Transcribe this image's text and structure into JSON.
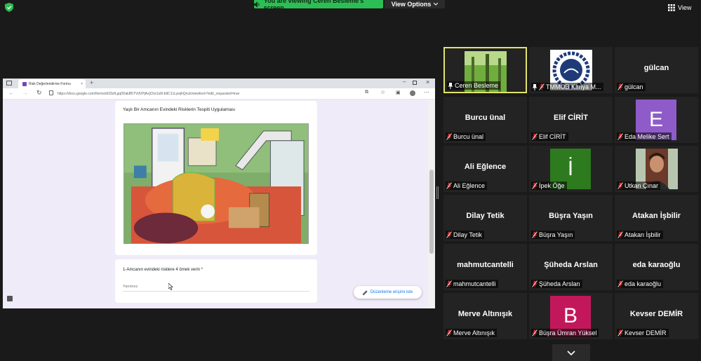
{
  "top_bar": {
    "banner_text": "You are viewing Ceren Besleme's screen",
    "view_options_label": "View Options",
    "view_label": "View"
  },
  "shared_screen": {
    "tab_title": "Risk Değerlendirme Formu",
    "url": "https://docs.google.com/forms/d/18zfLgq0DakB5TVdVPjAxjChx1o6l-b9C1cLywjhQnck/viewform?edit_requested=true",
    "form_title": "Yaşlı Bir Amcanın Evindeki Risklerin Tespiti Uygulaması",
    "question": "1-Amcanın evindeki risklere 4 örnek verin *",
    "answer_placeholder": "Yanıtınız",
    "edit_access_button": "Düzenleme erişimi iste"
  },
  "participants": [
    {
      "label": "Ceren Besleme",
      "display": "",
      "muted": false,
      "pinned": true,
      "active": true,
      "video": "forest"
    },
    {
      "label": "TMMOB Kimya M...",
      "display": "",
      "muted": true,
      "pinned": true,
      "video": "logo"
    },
    {
      "label": "gülcan",
      "display": "gülcan",
      "muted": true
    },
    {
      "label": "Burcu ünal",
      "display": "Burcu ünal",
      "muted": true
    },
    {
      "label": "Elif CİRİT",
      "display": "Elif CİRİT",
      "muted": true
    },
    {
      "label": "Eda Melike Sert",
      "display": "",
      "muted": true,
      "avatar_letter": "E",
      "avatar_color": "#8f5bc9"
    },
    {
      "label": "Ali Eğlence",
      "display": "Ali Eğlence",
      "muted": true
    },
    {
      "label": "İpek Öğe",
      "display": "",
      "muted": true,
      "avatar_letter": "İ",
      "avatar_color": "#2e7a1f"
    },
    {
      "label": "Utkan Çınar",
      "display": "",
      "muted": true,
      "video": "person"
    },
    {
      "label": "Dilay Tetik",
      "display": "Dilay Tetik",
      "muted": true
    },
    {
      "label": "Büşra Yaşın",
      "display": "Büşra Yaşın",
      "muted": true
    },
    {
      "label": "Atakan İşbilir",
      "display": "Atakan İşbilir",
      "muted": true
    },
    {
      "label": "mahmutcantelli",
      "display": "mahmutcantelli",
      "muted": true
    },
    {
      "label": "Şüheda Arslan",
      "display": "Şüheda Arslan",
      "muted": true
    },
    {
      "label": "eda karaoğlu",
      "display": "eda karaoğlu",
      "muted": true
    },
    {
      "label": "Merve Altınışık",
      "display": "Merve Altınışık",
      "muted": true
    },
    {
      "label": "Büşra Ümran Yüksel",
      "display": "",
      "muted": true,
      "avatar_letter": "B",
      "avatar_color": "#c2185b"
    },
    {
      "label": "Kevser DEMİR",
      "display": "Kevser DEMİR",
      "muted": true
    }
  ],
  "colors": {
    "accent_green": "#2dbd55",
    "active_speaker": "#e1e36b",
    "mute_red": "#e02828",
    "tile_bg": "#232323"
  }
}
